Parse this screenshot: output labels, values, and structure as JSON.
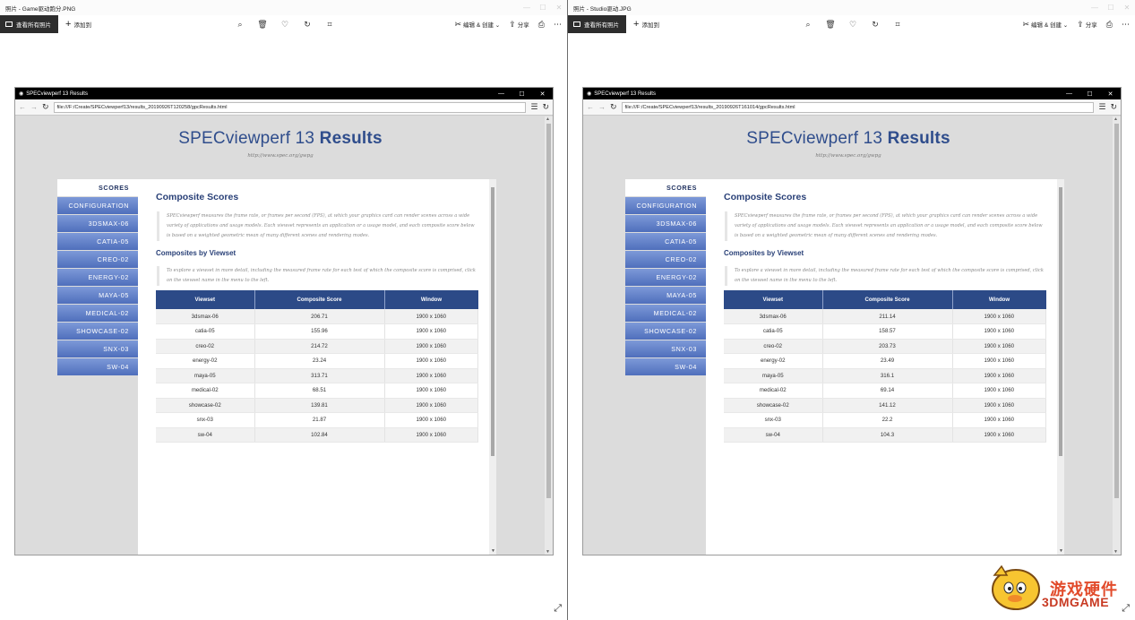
{
  "windows": [
    {
      "title": "照片 - Game驱动跑分.PNG",
      "browser": {
        "title": "SPECviewperf 13 Results",
        "url": "file:///F:/Create/SPECviewperf13/results_20190926T120258/gpcResults.html"
      },
      "rows": [
        [
          "3dsmax-06",
          "206.71",
          "1900 x 1060"
        ],
        [
          "catia-05",
          "155.96",
          "1900 x 1060"
        ],
        [
          "creo-02",
          "214.72",
          "1900 x 1060"
        ],
        [
          "energy-02",
          "23.24",
          "1900 x 1060"
        ],
        [
          "maya-05",
          "313.71",
          "1900 x 1060"
        ],
        [
          "medical-02",
          "68.51",
          "1900 x 1060"
        ],
        [
          "showcase-02",
          "139.81",
          "1900 x 1060"
        ],
        [
          "snx-03",
          "21.87",
          "1900 x 1060"
        ],
        [
          "sw-04",
          "102.84",
          "1900 x 1060"
        ]
      ]
    },
    {
      "title": "照片 - Studio驱动.JPG",
      "browser": {
        "title": "SPECviewperf 13 Results",
        "url": "file:///F:/Create/SPECviewperf13/results_20190926T161014/gpcResults.html"
      },
      "rows": [
        [
          "3dsmax-06",
          "211.14",
          "1900 x 1060"
        ],
        [
          "catia-05",
          "158.57",
          "1900 x 1060"
        ],
        [
          "creo-02",
          "203.73",
          "1900 x 1060"
        ],
        [
          "energy-02",
          "23.49",
          "1900 x 1060"
        ],
        [
          "maya-05",
          "316.1",
          "1900 x 1060"
        ],
        [
          "medical-02",
          "69.14",
          "1900 x 1060"
        ],
        [
          "showcase-02",
          "141.12",
          "1900 x 1060"
        ],
        [
          "snx-03",
          "22.2",
          "1900 x 1060"
        ],
        [
          "sw-04",
          "104.3",
          "1900 x 1060"
        ]
      ]
    }
  ],
  "photos_toolbar": {
    "view_all": "查看所有照片",
    "add_to": "添加到",
    "edit_create": "编辑 & 创建",
    "share": "分享",
    "icons": [
      "zoom-icon",
      "delete-icon",
      "favorite-icon",
      "rotate-icon",
      "crop-icon"
    ]
  },
  "page": {
    "heading_light": "SPECviewperf 13 ",
    "heading_bold": "Results",
    "subheading": "http://www.spec.org/gwpg",
    "nav": [
      "SCORES",
      "CONFIGURATION",
      "3DSMAX-06",
      "CATIA-05",
      "CREO-02",
      "ENERGY-02",
      "MAYA-05",
      "MEDICAL-02",
      "SHOWCASE-02",
      "SNX-03",
      "SW-04"
    ],
    "composite_title": "Composite Scores",
    "composite_desc": "SPECviewperf measures the frame rate, or frames per second (FPS), at which your graphics card can render scenes across a wide variety of applications and usage models. Each viewset represents an application or a usage model, and each composite score below is based on a weighted geometric mean of many different scenes and rendering modes.",
    "viewset_title": "Composites by Viewset",
    "viewset_desc": "To explore a viewset in more detail, including the measured frame rate for each test of which the composite score is comprised, click on the viewset name in the menu to the left.",
    "table_headers": [
      "Viewset",
      "Composite Score",
      "Window"
    ]
  },
  "watermark": {
    "line1": "游戏硬件",
    "line2": "3DMGAME"
  },
  "colors": {
    "heading": "#2f4d8c",
    "nav_gradient_top": "#7d99d8",
    "nav_gradient_bottom": "#4f6fbc",
    "table_header": "#2c4a87"
  }
}
